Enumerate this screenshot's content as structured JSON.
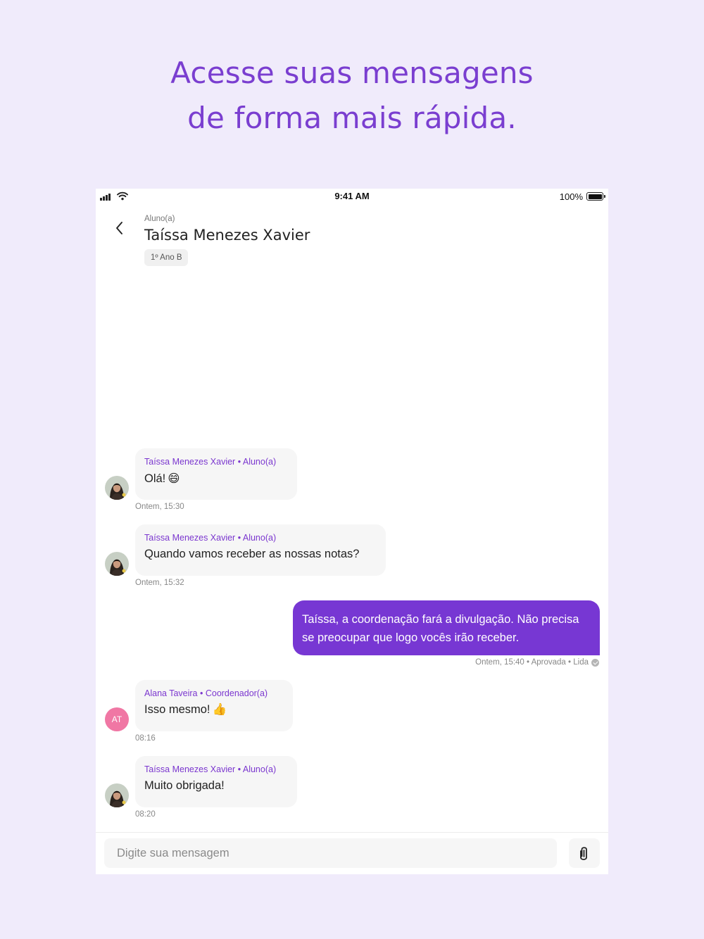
{
  "promo": {
    "line1": "Acesse suas mensagens",
    "line2": "de forma mais rápida."
  },
  "status_bar": {
    "time": "9:41 AM",
    "battery": "100%"
  },
  "header": {
    "role": "Aluno(a)",
    "name": "Taíssa Menezes Xavier",
    "class": "1º Ano B"
  },
  "messages": [
    {
      "direction": "incoming",
      "sender": "Taíssa Menezes Xavier • Aluno(a)",
      "text": "Olá!",
      "emoji": "😄",
      "time": "Ontem, 15:30",
      "avatar": "photo"
    },
    {
      "direction": "incoming",
      "sender": "Taíssa Menezes Xavier • Aluno(a)",
      "text": "Quando vamos receber as nossas notas?",
      "time": "Ontem, 15:32",
      "avatar": "photo"
    },
    {
      "direction": "outgoing",
      "line1": "Taíssa, a coordenação fará a divulgação. Não precisa",
      "line2": "se preocupar que logo vocês irão receber.",
      "meta": "Ontem, 15:40 • Aprovada • Lida"
    },
    {
      "direction": "incoming",
      "sender": "Alana Taveira • Coordenador(a)",
      "text": "Isso mesmo!",
      "emoji": "👍",
      "time": "08:16",
      "avatar_initials": "AT"
    },
    {
      "direction": "incoming",
      "sender": "Taíssa Menezes Xavier • Aluno(a)",
      "text": "Muito obrigada!",
      "time": "08:20",
      "avatar": "photo"
    }
  ],
  "composer": {
    "placeholder": "Digite sua mensagem"
  },
  "icons": {
    "back": "chevron-left-icon",
    "attach": "paperclip-icon",
    "read": "check-circle-icon",
    "signal": "signal-icon",
    "wifi": "wifi-icon",
    "battery": "battery-icon"
  },
  "colors": {
    "background": "#f0ebfb",
    "accent": "#7737d3",
    "headline": "#7a3ed0",
    "incoming_bubble": "#f6f6f6",
    "initials_avatar": "#f077a4"
  }
}
